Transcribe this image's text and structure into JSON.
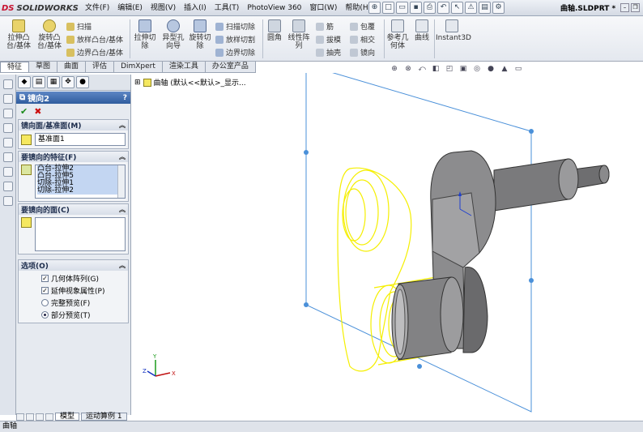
{
  "app": {
    "logo_ds": "DS",
    "logo_name": "SOLIDWORKS",
    "doc_title": "曲轴.SLDPRT *"
  },
  "menu": [
    "文件(F)",
    "编辑(E)",
    "视图(V)",
    "插入(I)",
    "工具(T)",
    "PhotoView 360",
    "窗口(W)",
    "帮助(H)"
  ],
  "ribbon": {
    "extrude_boss": "拉伸凸台/基体",
    "revolve_boss": "旋转凸台/基体",
    "sweep": "扫描",
    "loft_boss": "放样凸台/基体",
    "boundary_boss": "边界凸台/基体",
    "extrude_cut": "拉伸切除",
    "hole_wizard": "异型孔向导",
    "revolve_cut": "旋转切除",
    "swept_cut": "扫描切除",
    "lofted_cut": "放样切割",
    "boundary_cut": "边界切除",
    "fillet": "圆角",
    "linear_pattern": "线性阵列",
    "rib": "筋",
    "draft": "拔模",
    "shell": "抽壳",
    "wrap": "包覆",
    "intersect": "相交",
    "mirror": "镜向",
    "ref_geometry": "参考几何体",
    "curves": "曲线",
    "instant3d": "Instant3D"
  },
  "tabs": [
    "特征",
    "草图",
    "曲面",
    "评估",
    "DimXpert",
    "渲染工具",
    "办公室产品"
  ],
  "active_tab": 0,
  "panel": {
    "title": "镜向2",
    "help": "?",
    "mirror_face_header": "镜向面/基准面(M)",
    "mirror_face_value": "基准面1",
    "features_header": "要镜向的特征(F)",
    "features": [
      "凸台-拉伸2",
      "凸台-拉伸5",
      "切除-拉伸1",
      "切除-拉伸2"
    ],
    "faces_header": "要镜向的面(C)",
    "options_header": "选项(O)",
    "options": [
      {
        "label": "几何体阵列(G)",
        "kind": "checkbox",
        "checked": true
      },
      {
        "label": "延伸视象属性(P)",
        "kind": "checkbox",
        "checked": true
      },
      {
        "label": "完整预览(F)",
        "kind": "radio",
        "checked": false
      },
      {
        "label": "部分预览(T)",
        "kind": "radio",
        "checked": true
      }
    ]
  },
  "tree": {
    "label": "曲轴 (默认<<默认>_显示..."
  },
  "bottom_tabs": [
    "模型",
    "运动算例 1"
  ],
  "status": "曲轴",
  "colors": {
    "accent": "#2f5c9e",
    "preview": "#ffff00",
    "plane": "#4a90d9",
    "part": "#7a7a7a"
  }
}
